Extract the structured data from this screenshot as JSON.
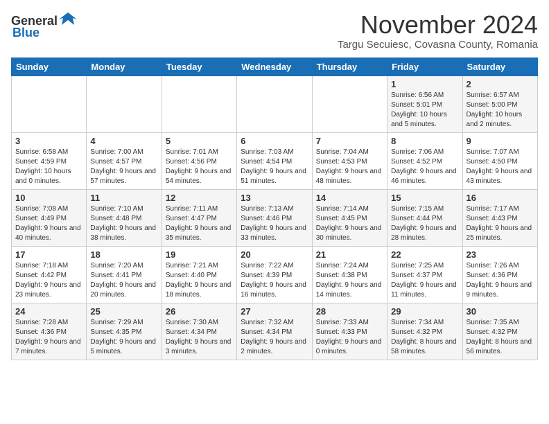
{
  "logo": {
    "general": "General",
    "blue": "Blue"
  },
  "header": {
    "month": "November 2024",
    "location": "Targu Secuiesc, Covasna County, Romania"
  },
  "columns": [
    "Sunday",
    "Monday",
    "Tuesday",
    "Wednesday",
    "Thursday",
    "Friday",
    "Saturday"
  ],
  "weeks": [
    [
      {
        "day": "",
        "info": ""
      },
      {
        "day": "",
        "info": ""
      },
      {
        "day": "",
        "info": ""
      },
      {
        "day": "",
        "info": ""
      },
      {
        "day": "",
        "info": ""
      },
      {
        "day": "1",
        "info": "Sunrise: 6:56 AM\nSunset: 5:01 PM\nDaylight: 10 hours and 5 minutes."
      },
      {
        "day": "2",
        "info": "Sunrise: 6:57 AM\nSunset: 5:00 PM\nDaylight: 10 hours and 2 minutes."
      }
    ],
    [
      {
        "day": "3",
        "info": "Sunrise: 6:58 AM\nSunset: 4:59 PM\nDaylight: 10 hours and 0 minutes."
      },
      {
        "day": "4",
        "info": "Sunrise: 7:00 AM\nSunset: 4:57 PM\nDaylight: 9 hours and 57 minutes."
      },
      {
        "day": "5",
        "info": "Sunrise: 7:01 AM\nSunset: 4:56 PM\nDaylight: 9 hours and 54 minutes."
      },
      {
        "day": "6",
        "info": "Sunrise: 7:03 AM\nSunset: 4:54 PM\nDaylight: 9 hours and 51 minutes."
      },
      {
        "day": "7",
        "info": "Sunrise: 7:04 AM\nSunset: 4:53 PM\nDaylight: 9 hours and 48 minutes."
      },
      {
        "day": "8",
        "info": "Sunrise: 7:06 AM\nSunset: 4:52 PM\nDaylight: 9 hours and 46 minutes."
      },
      {
        "day": "9",
        "info": "Sunrise: 7:07 AM\nSunset: 4:50 PM\nDaylight: 9 hours and 43 minutes."
      }
    ],
    [
      {
        "day": "10",
        "info": "Sunrise: 7:08 AM\nSunset: 4:49 PM\nDaylight: 9 hours and 40 minutes."
      },
      {
        "day": "11",
        "info": "Sunrise: 7:10 AM\nSunset: 4:48 PM\nDaylight: 9 hours and 38 minutes."
      },
      {
        "day": "12",
        "info": "Sunrise: 7:11 AM\nSunset: 4:47 PM\nDaylight: 9 hours and 35 minutes."
      },
      {
        "day": "13",
        "info": "Sunrise: 7:13 AM\nSunset: 4:46 PM\nDaylight: 9 hours and 33 minutes."
      },
      {
        "day": "14",
        "info": "Sunrise: 7:14 AM\nSunset: 4:45 PM\nDaylight: 9 hours and 30 minutes."
      },
      {
        "day": "15",
        "info": "Sunrise: 7:15 AM\nSunset: 4:44 PM\nDaylight: 9 hours and 28 minutes."
      },
      {
        "day": "16",
        "info": "Sunrise: 7:17 AM\nSunset: 4:43 PM\nDaylight: 9 hours and 25 minutes."
      }
    ],
    [
      {
        "day": "17",
        "info": "Sunrise: 7:18 AM\nSunset: 4:42 PM\nDaylight: 9 hours and 23 minutes."
      },
      {
        "day": "18",
        "info": "Sunrise: 7:20 AM\nSunset: 4:41 PM\nDaylight: 9 hours and 20 minutes."
      },
      {
        "day": "19",
        "info": "Sunrise: 7:21 AM\nSunset: 4:40 PM\nDaylight: 9 hours and 18 minutes."
      },
      {
        "day": "20",
        "info": "Sunrise: 7:22 AM\nSunset: 4:39 PM\nDaylight: 9 hours and 16 minutes."
      },
      {
        "day": "21",
        "info": "Sunrise: 7:24 AM\nSunset: 4:38 PM\nDaylight: 9 hours and 14 minutes."
      },
      {
        "day": "22",
        "info": "Sunrise: 7:25 AM\nSunset: 4:37 PM\nDaylight: 9 hours and 11 minutes."
      },
      {
        "day": "23",
        "info": "Sunrise: 7:26 AM\nSunset: 4:36 PM\nDaylight: 9 hours and 9 minutes."
      }
    ],
    [
      {
        "day": "24",
        "info": "Sunrise: 7:28 AM\nSunset: 4:36 PM\nDaylight: 9 hours and 7 minutes."
      },
      {
        "day": "25",
        "info": "Sunrise: 7:29 AM\nSunset: 4:35 PM\nDaylight: 9 hours and 5 minutes."
      },
      {
        "day": "26",
        "info": "Sunrise: 7:30 AM\nSunset: 4:34 PM\nDaylight: 9 hours and 3 minutes."
      },
      {
        "day": "27",
        "info": "Sunrise: 7:32 AM\nSunset: 4:34 PM\nDaylight: 9 hours and 2 minutes."
      },
      {
        "day": "28",
        "info": "Sunrise: 7:33 AM\nSunset: 4:33 PM\nDaylight: 9 hours and 0 minutes."
      },
      {
        "day": "29",
        "info": "Sunrise: 7:34 AM\nSunset: 4:32 PM\nDaylight: 8 hours and 58 minutes."
      },
      {
        "day": "30",
        "info": "Sunrise: 7:35 AM\nSunset: 4:32 PM\nDaylight: 8 hours and 56 minutes."
      }
    ]
  ]
}
